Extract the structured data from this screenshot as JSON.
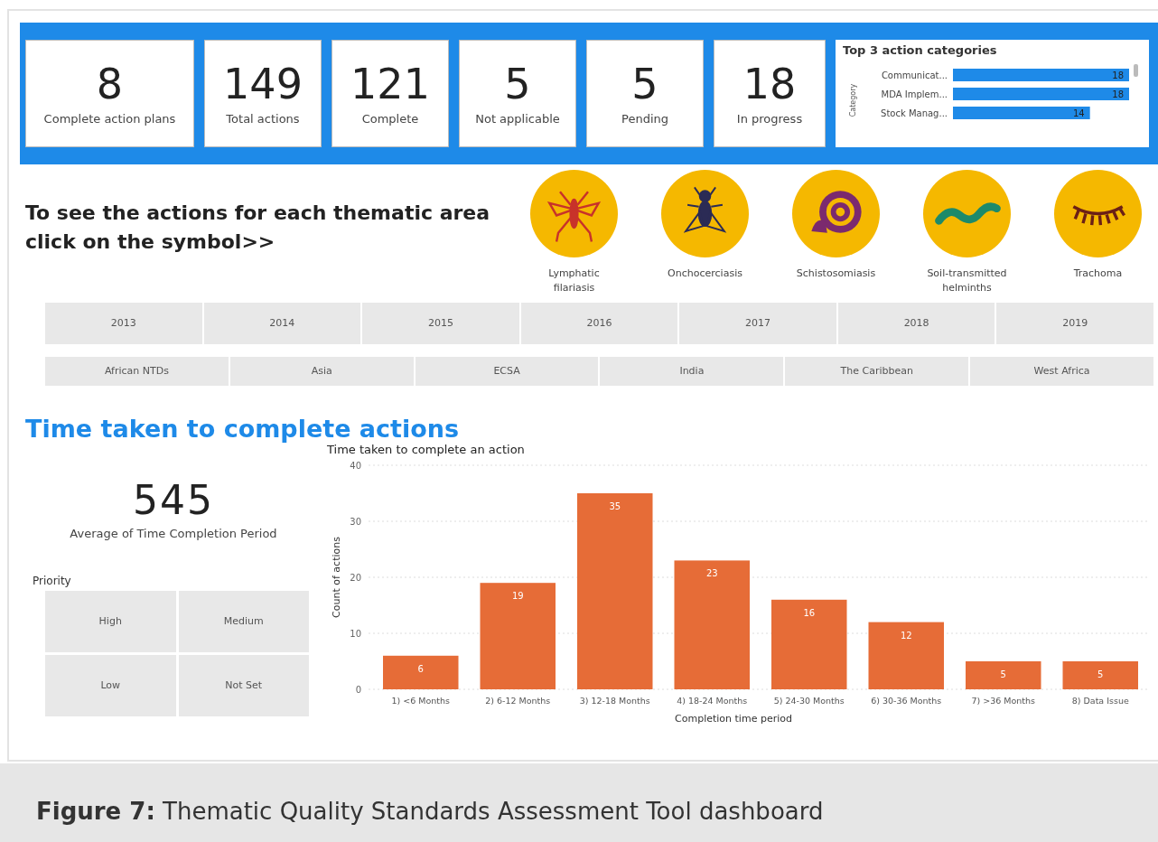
{
  "kpis": [
    {
      "value": "8",
      "label": "Complete action plans"
    },
    {
      "value": "149",
      "label": "Total actions"
    },
    {
      "value": "121",
      "label": "Complete"
    },
    {
      "value": "5",
      "label": "Not applicable"
    },
    {
      "value": "5",
      "label": "Pending"
    },
    {
      "value": "18",
      "label": "In progress"
    }
  ],
  "top_categories": {
    "title": "Top 3 action categories",
    "chart_data": {
      "type": "bar",
      "orientation": "horizontal",
      "ylabel": "Category",
      "categories": [
        "Communicat...",
        "MDA Implem...",
        "Stock Manag..."
      ],
      "values": [
        18,
        18,
        14
      ],
      "data_labels": true
    }
  },
  "instruction": "To see the actions for each thematic area click on the symbol>>",
  "thematic_areas": [
    {
      "kind": "mosquito",
      "label": "Lymphatic filariasis"
    },
    {
      "kind": "fly",
      "label": "Onchocerciasis"
    },
    {
      "kind": "snail",
      "label": "Schistosomiasis"
    },
    {
      "kind": "worm",
      "label": "Soil-transmitted helminths"
    },
    {
      "kind": "eyelash",
      "label": "Trachoma"
    }
  ],
  "year_slicer": [
    "2013",
    "2014",
    "2015",
    "2016",
    "2017",
    "2018",
    "2019"
  ],
  "region_slicer": [
    "African NTDs",
    "Asia",
    "ECSA",
    "India",
    "The Caribbean",
    "West Africa"
  ],
  "section_title": "Time taken to complete actions",
  "average": {
    "value": "545",
    "label": "Average of Time Completion Period"
  },
  "priority": {
    "title": "Priority",
    "options": [
      "High",
      "Medium",
      "Low",
      "Not Set"
    ]
  },
  "completion_chart": {
    "title": "Time taken to complete an action",
    "chart_data": {
      "type": "bar",
      "xlabel": "Completion time period",
      "ylabel": "Count of actions",
      "categories": [
        "1) <6 Months",
        "2) 6-12 Months",
        "3) 12-18 Months",
        "4) 18-24 Months",
        "5) 24-30 Months",
        "6) 30-36 Months",
        "7) >36 Months",
        "8) Data Issue"
      ],
      "values": [
        6,
        19,
        35,
        23,
        16,
        12,
        5,
        5
      ],
      "grid": true,
      "ylim": [
        0,
        40
      ],
      "yticks": [
        0,
        10,
        20,
        30,
        40
      ],
      "data_labels": true
    }
  },
  "caption": "**Figure 7:** Thematic Quality Standards Assessment Tool dashboard"
}
